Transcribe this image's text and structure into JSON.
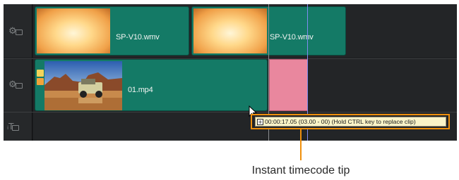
{
  "tracks": [
    {
      "icon": "video-track-icon",
      "clips": [
        {
          "name": "SP-V10.wmv",
          "thumbnail": "orange-gradient-thumbnail"
        },
        {
          "name": "SP-V10.wmv",
          "thumbnail": "orange-gradient-thumbnail"
        }
      ]
    },
    {
      "icon": "overlay-track-icon",
      "clips": [
        {
          "name": "01.mp4",
          "thumbnail": "desert-jeep-thumbnail"
        }
      ]
    },
    {
      "icon": "title-track-icon",
      "clips": []
    }
  ],
  "tooltip": {
    "text": "00:00:17.05 (03.00 - 00) (Hold CTRL key to replace clip)"
  },
  "callout": {
    "caption": "Instant timecode tip"
  },
  "colors": {
    "clip": "#147a66",
    "placeholder": "#e9879e",
    "highlight": "#f0900c",
    "tooltip_bg": "#fbf4c8"
  }
}
